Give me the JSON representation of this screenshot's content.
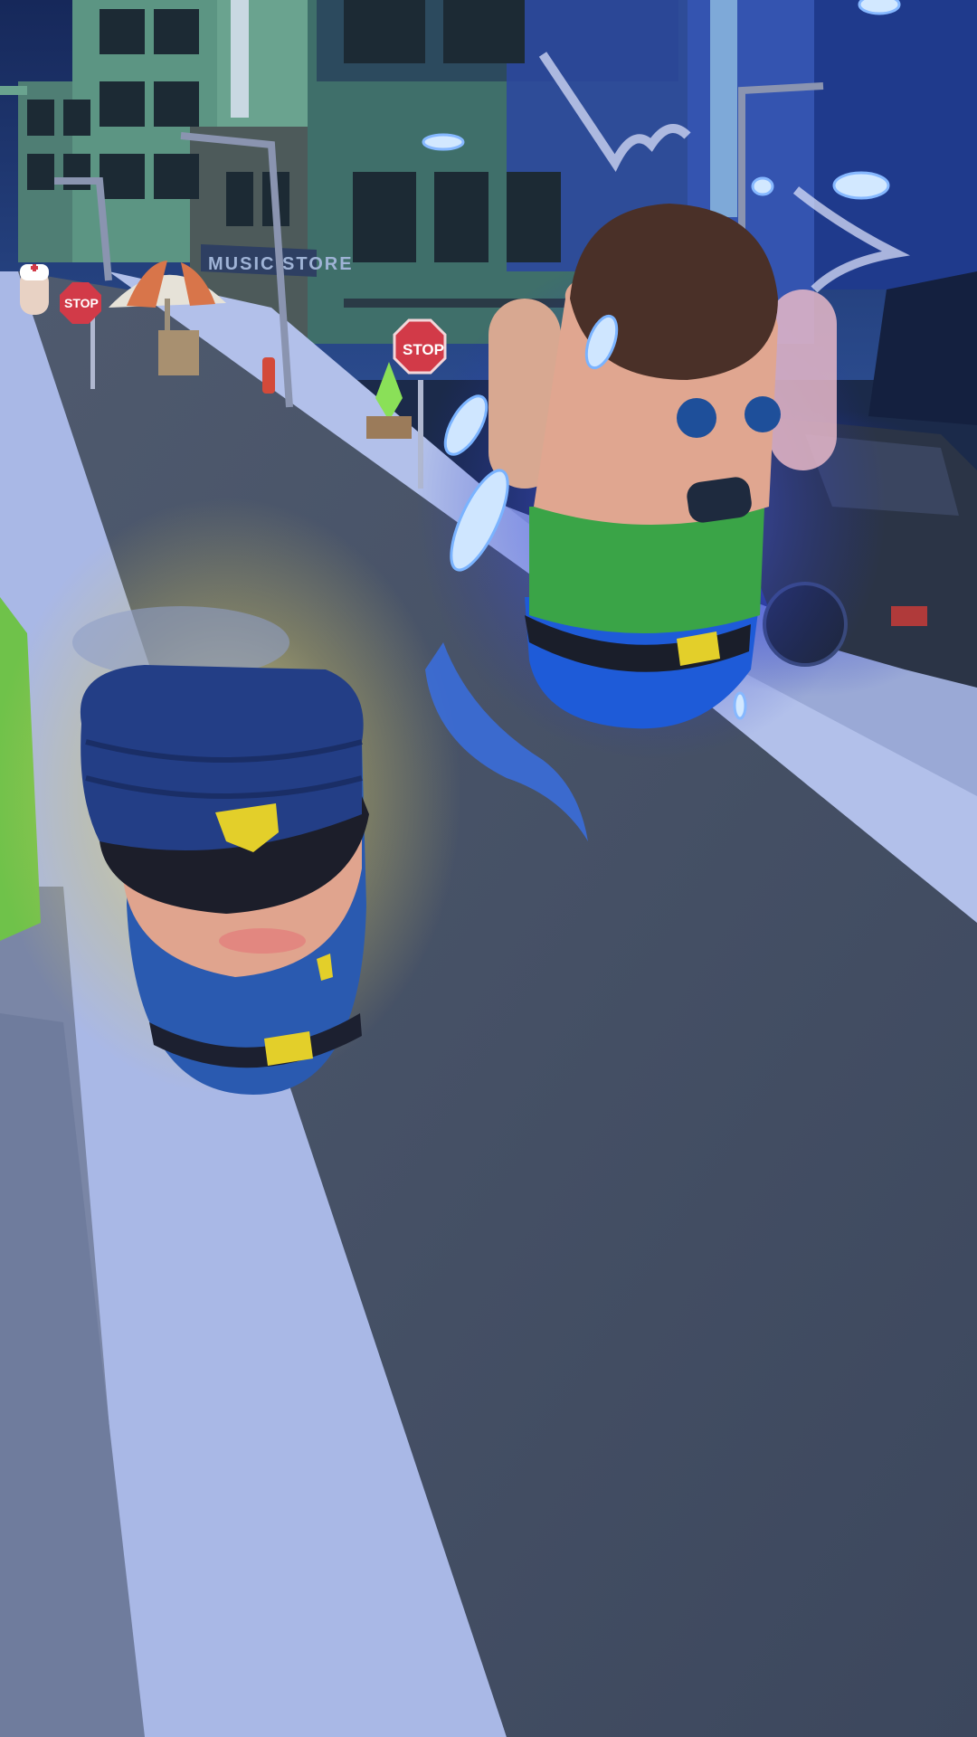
{
  "scene": {
    "store_sign": "MUSIC STORE",
    "stop_sign_near": "STOP",
    "stop_sign_far": "STOP"
  },
  "colors": {
    "sky": "#1d3467",
    "road": "#45526a",
    "sidewalk": "#a9b8e6",
    "building": "#5f9a86",
    "police_uniform": "#1e3a7a",
    "badge": "#e3cf2a",
    "ghost_shirt": "#3aa447",
    "ghost_glow": "#4a6cff"
  }
}
